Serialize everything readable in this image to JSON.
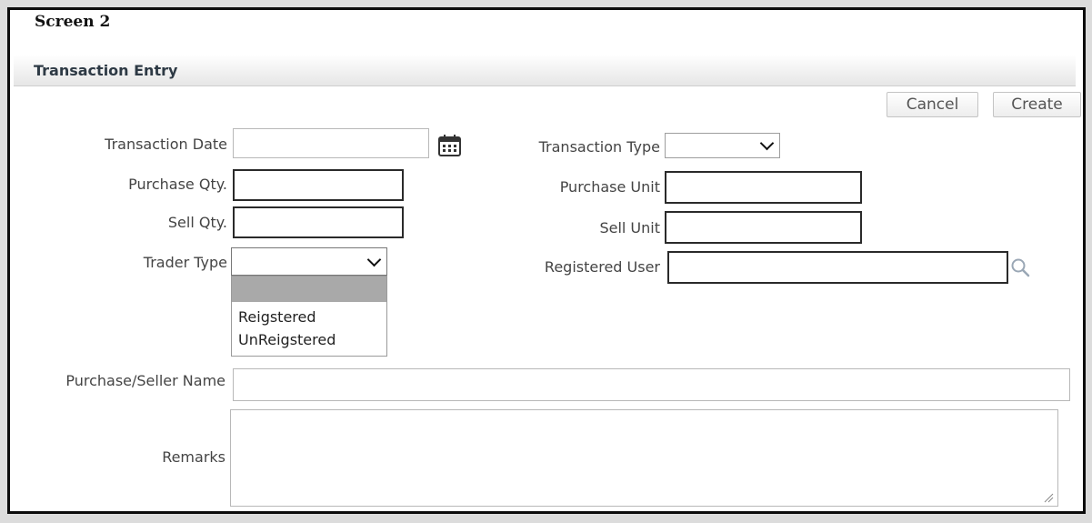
{
  "screen": {
    "title": "Screen 2"
  },
  "header": {
    "title": "Transaction Entry"
  },
  "actions": {
    "cancel_label": "Cancel",
    "create_label": "Create"
  },
  "form": {
    "transaction_date": {
      "label": "Transaction Date",
      "value": ""
    },
    "transaction_type": {
      "label": "Transaction Type",
      "value": ""
    },
    "purchase_qty": {
      "label": "Purchase Qty.",
      "value": ""
    },
    "purchase_unit": {
      "label": "Purchase Unit",
      "value": ""
    },
    "sell_qty": {
      "label": "Sell Qty.",
      "value": ""
    },
    "sell_unit": {
      "label": "Sell Unit",
      "value": ""
    },
    "trader_type": {
      "label": "Trader Type",
      "value": "",
      "options": [
        "",
        "Reigstered",
        "UnReigstered"
      ]
    },
    "registered_user": {
      "label": "Registered User",
      "value": ""
    },
    "purchase_seller_name": {
      "label": "Purchase/Seller Name",
      "value": ""
    },
    "remarks": {
      "label": "Remarks",
      "value": ""
    }
  },
  "icons": {
    "date_picker": "calendar-icon",
    "lookup": "search-icon",
    "dropdown": "chevron-down-icon",
    "resize": "resize-handle-icon"
  },
  "colors": {
    "page_bg": "#ffffff",
    "header_text": "#2e3a45",
    "dropdown_highlight": "#a9a9a9",
    "frame_border": "#0b0b0b"
  }
}
